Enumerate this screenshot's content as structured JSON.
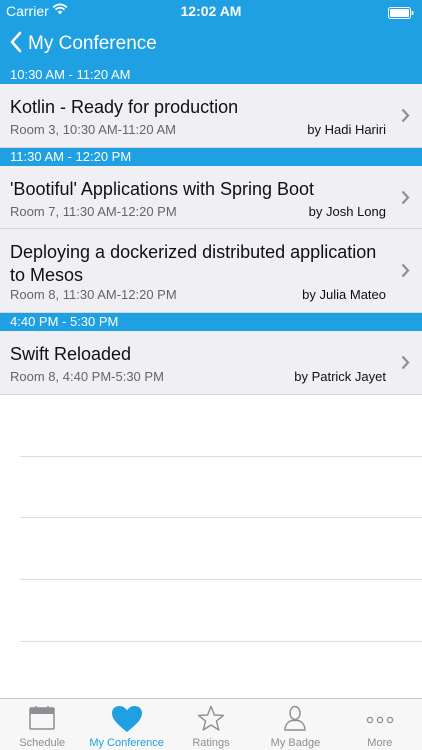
{
  "status": {
    "carrier": "Carrier",
    "time": "12:02 AM"
  },
  "nav": {
    "back_label": "My Conference"
  },
  "sections": [
    {
      "header": "10:30 AM - 11:20 AM",
      "items": [
        {
          "title": "Kotlin  - Ready for production",
          "meta": "Room 3, 10:30 AM-11:20 AM",
          "speaker": "by Hadi Hariri"
        }
      ]
    },
    {
      "header": "11:30 AM - 12:20 PM",
      "items": [
        {
          "title": "'Bootiful' Applications with Spring Boot",
          "meta": "Room 7, 11:30 AM-12:20 PM",
          "speaker": "by Josh Long"
        },
        {
          "title": "Deploying a dockerized distributed application to Mesos",
          "meta": "Room 8, 11:30 AM-12:20 PM",
          "speaker": "by Julia Mateo"
        }
      ]
    },
    {
      "header": "4:40 PM - 5:30 PM",
      "items": [
        {
          "title": "Swift Reloaded",
          "meta": "Room 8, 4:40 PM-5:30 PM",
          "speaker": "by Patrick Jayet"
        }
      ]
    }
  ],
  "tabbar": {
    "tabs": [
      {
        "label": "Schedule",
        "icon": "calendar-icon"
      },
      {
        "label": "My Conference",
        "icon": "heart-icon",
        "active": true
      },
      {
        "label": "Ratings",
        "icon": "star-icon"
      },
      {
        "label": "My Badge",
        "icon": "person-icon"
      },
      {
        "label": "More",
        "icon": "more-icon"
      }
    ]
  },
  "colors": {
    "accent": "#1ea0e2",
    "row_background": "#efeff4",
    "tab_inactive": "#8e8e93"
  }
}
